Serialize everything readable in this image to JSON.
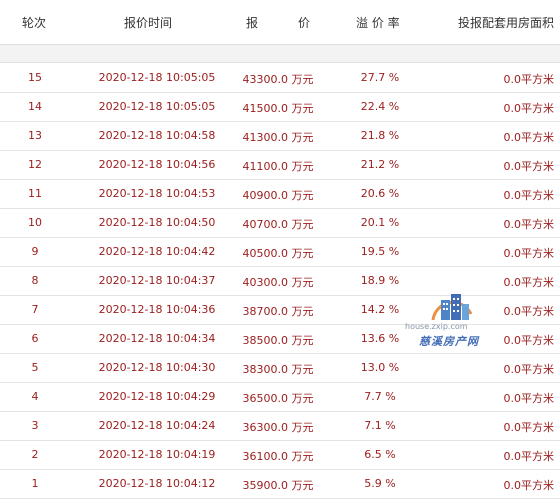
{
  "header": {
    "round": "轮次",
    "time": "报价时间",
    "price_left": "报",
    "price_right": "价",
    "premium": "溢 价 率",
    "area": "投报配套用房面积"
  },
  "watermark": {
    "url": "house.zxip.com",
    "name": "慈溪房产网"
  },
  "rows": [
    {
      "round": "15",
      "time": "2020-12-18 10:05:05",
      "price": "43300.0 万元",
      "premium": "27.7 %",
      "area": "0.0平方米"
    },
    {
      "round": "14",
      "time": "2020-12-18 10:05:05",
      "price": "41500.0 万元",
      "premium": "22.4 %",
      "area": "0.0平方米"
    },
    {
      "round": "13",
      "time": "2020-12-18 10:04:58",
      "price": "41300.0 万元",
      "premium": "21.8 %",
      "area": "0.0平方米"
    },
    {
      "round": "12",
      "time": "2020-12-18 10:04:56",
      "price": "41100.0 万元",
      "premium": "21.2 %",
      "area": "0.0平方米"
    },
    {
      "round": "11",
      "time": "2020-12-18 10:04:53",
      "price": "40900.0 万元",
      "premium": "20.6 %",
      "area": "0.0平方米"
    },
    {
      "round": "10",
      "time": "2020-12-18 10:04:50",
      "price": "40700.0 万元",
      "premium": "20.1 %",
      "area": "0.0平方米"
    },
    {
      "round": "9",
      "time": "2020-12-18 10:04:42",
      "price": "40500.0 万元",
      "premium": "19.5 %",
      "area": "0.0平方米"
    },
    {
      "round": "8",
      "time": "2020-12-18 10:04:37",
      "price": "40300.0 万元",
      "premium": "18.9 %",
      "area": "0.0平方米"
    },
    {
      "round": "7",
      "time": "2020-12-18 10:04:36",
      "price": "38700.0 万元",
      "premium": "14.2 %",
      "area": "0.0平方米"
    },
    {
      "round": "6",
      "time": "2020-12-18 10:04:34",
      "price": "38500.0 万元",
      "premium": "13.6 %",
      "area": "0.0平方米"
    },
    {
      "round": "5",
      "time": "2020-12-18 10:04:30",
      "price": "38300.0 万元",
      "premium": "13.0 %",
      "area": "0.0平方米"
    },
    {
      "round": "4",
      "time": "2020-12-18 10:04:29",
      "price": "36500.0 万元",
      "premium": "7.7 %",
      "area": "0.0平方米"
    },
    {
      "round": "3",
      "time": "2020-12-18 10:04:24",
      "price": "36300.0 万元",
      "premium": "7.1 %",
      "area": "0.0平方米"
    },
    {
      "round": "2",
      "time": "2020-12-18 10:04:19",
      "price": "36100.0 万元",
      "premium": "6.5 %",
      "area": "0.0平方米"
    },
    {
      "round": "1",
      "time": "2020-12-18 10:04:12",
      "price": "35900.0 万元",
      "premium": "5.9 %",
      "area": "0.0平方米"
    }
  ]
}
